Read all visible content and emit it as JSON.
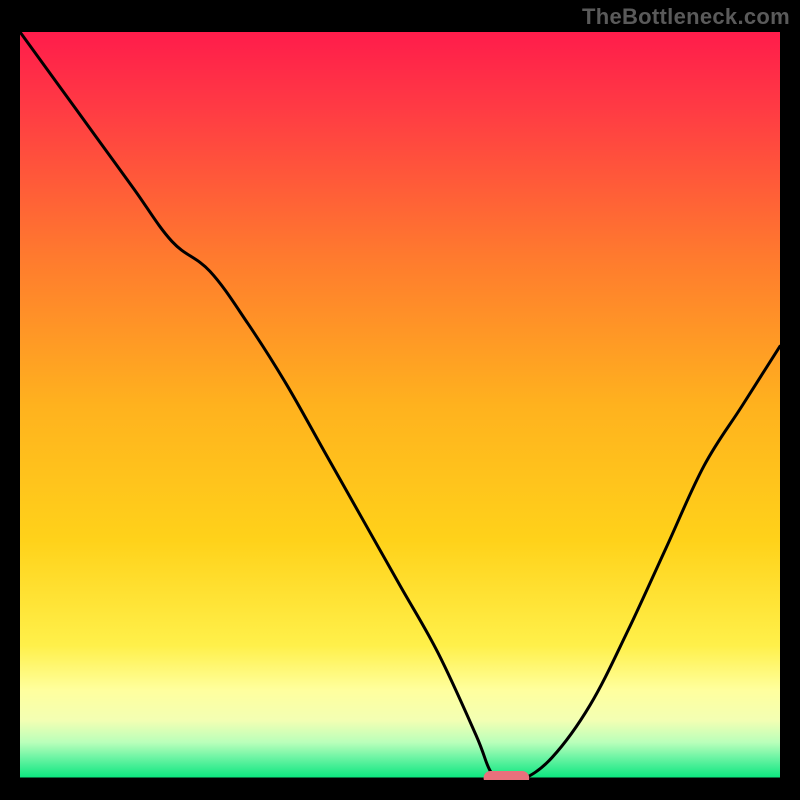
{
  "watermark": "TheBottleneck.com",
  "chart_data": {
    "type": "line",
    "title": "",
    "xlabel": "",
    "ylabel": "",
    "xlim": [
      0,
      100
    ],
    "ylim": [
      0,
      100
    ],
    "grid": false,
    "legend": false,
    "background_gradient": {
      "top_color": "#ff1c4b",
      "mid_color": "#ffd21a",
      "bottom_band_color": "#ffff9e",
      "bottom_color": "#00e57b"
    },
    "series": [
      {
        "name": "bottleneck-curve",
        "color": "#000000",
        "x": [
          0,
          5,
          10,
          15,
          20,
          25,
          30,
          35,
          40,
          45,
          50,
          55,
          60,
          62,
          64,
          66,
          70,
          75,
          80,
          85,
          90,
          95,
          100
        ],
        "y": [
          100,
          93,
          86,
          79,
          72,
          68,
          61,
          53,
          44,
          35,
          26,
          17,
          6,
          1,
          0,
          0,
          3,
          10,
          20,
          31,
          42,
          50,
          58
        ]
      }
    ],
    "marker": {
      "name": "optimal-marker",
      "shape": "rounded-rect",
      "color": "#e9707c",
      "center_x": 64,
      "center_y": 0,
      "width_x": 6,
      "height_y": 2
    }
  }
}
